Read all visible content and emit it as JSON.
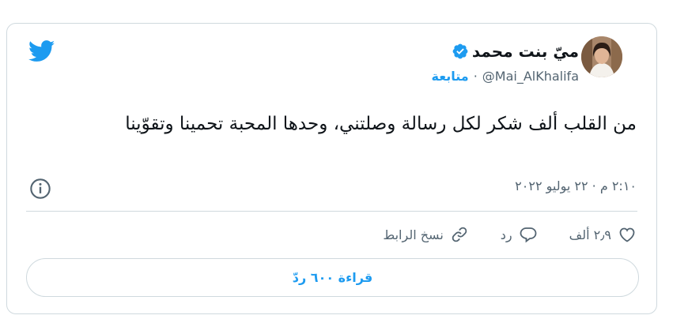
{
  "author": {
    "name": "ميّ بنت محمد",
    "handle": "@Mai_AlKhalifa",
    "follow_label": "متابعة",
    "separator": "·"
  },
  "tweet": {
    "text": "من القلب ألف شكر لكل رسالة وصلتني، وحدها المحبة تحمينا وتقوّينا",
    "timestamp": "٢:١٠ م · ٢٢ يوليو ٢٠٢٢"
  },
  "actions": {
    "like_count": "٢٫٩ ألف",
    "reply_label": "رد",
    "copy_link_label": "نسخ الرابط"
  },
  "read_replies_label": "قراءة ٦٠٠ ردّ",
  "colors": {
    "accent": "#1d9bf0",
    "text": "#0f1419",
    "secondary": "#536471",
    "border": "#cfd9de"
  },
  "icons": [
    "twitter-bird-icon",
    "verified-badge-icon",
    "info-icon",
    "heart-icon",
    "reply-bubble-icon",
    "link-icon"
  ]
}
